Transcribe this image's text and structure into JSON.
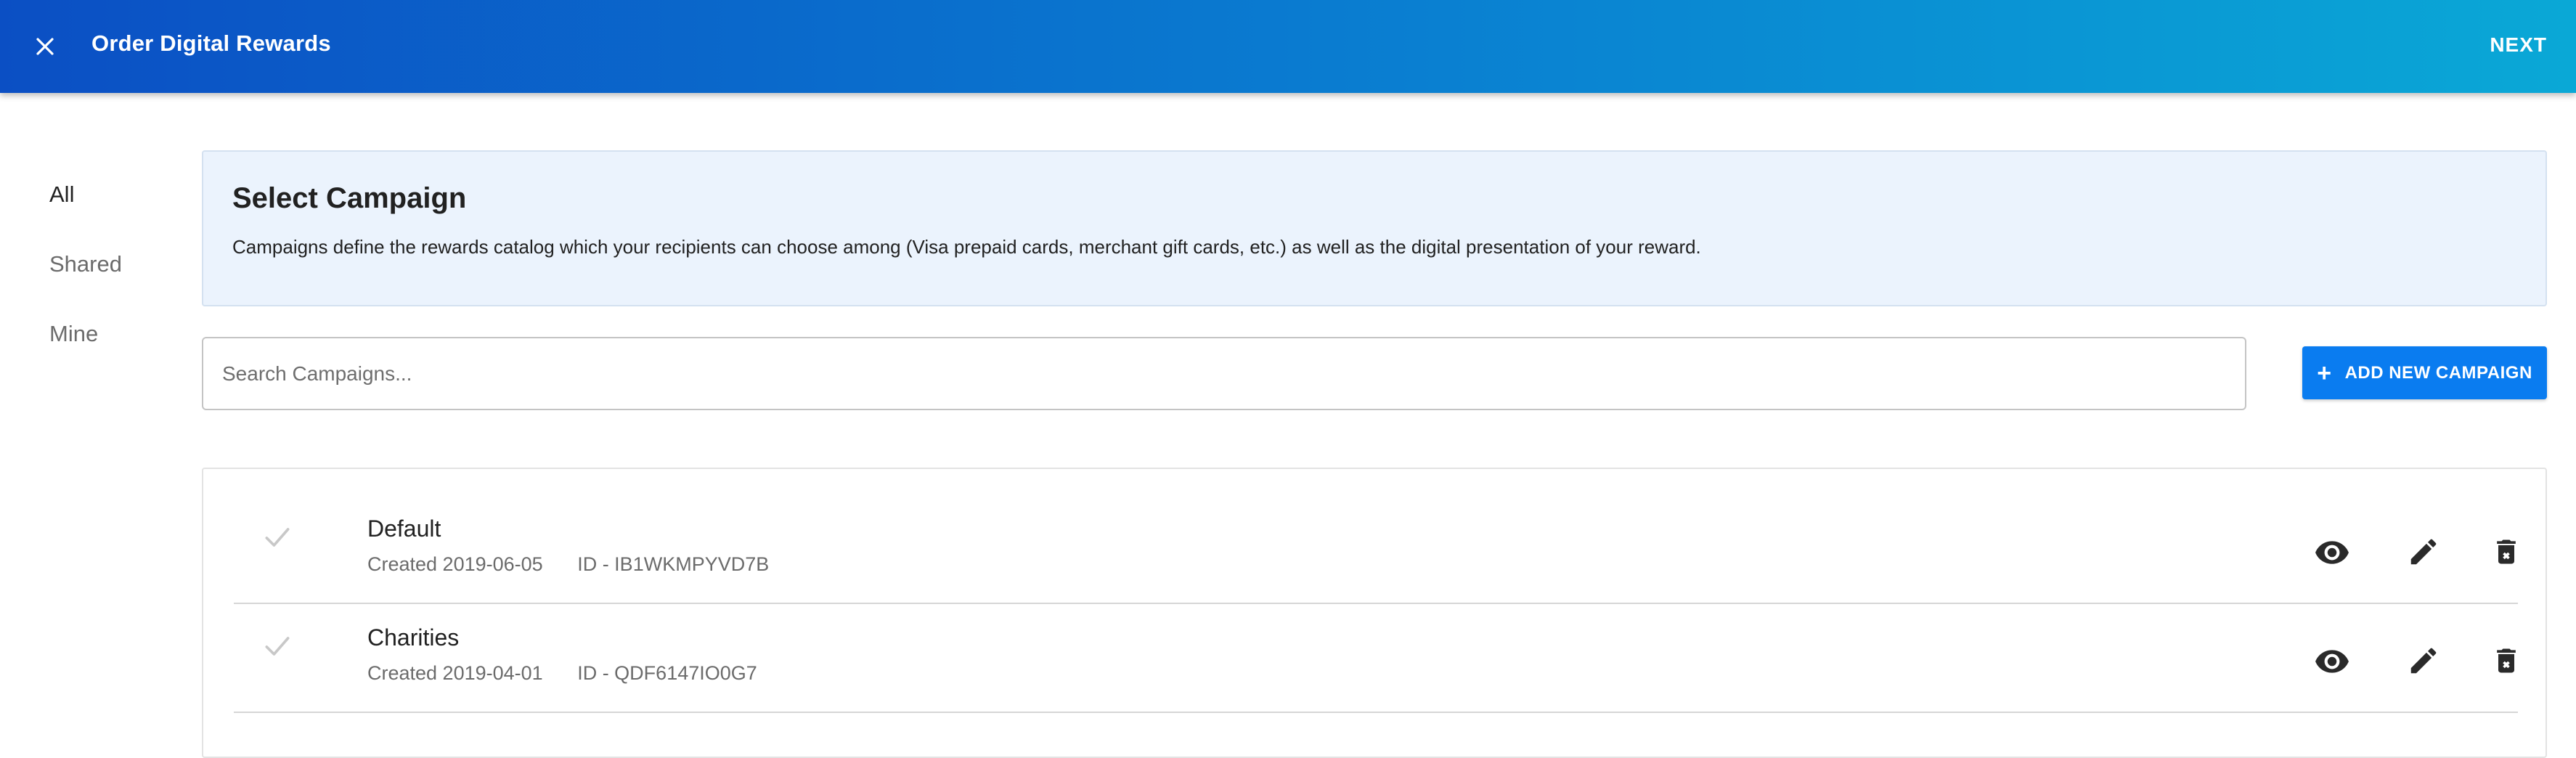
{
  "header": {
    "title": "Order Digital Rewards",
    "next_label": "NEXT",
    "close_icon": "close-icon"
  },
  "filters": [
    {
      "label": "All",
      "active": true
    },
    {
      "label": "Shared",
      "active": false
    },
    {
      "label": "Mine",
      "active": false
    }
  ],
  "info": {
    "title": "Select Campaign",
    "description": "Campaigns define the rewards catalog which your recipients can choose among (Visa prepaid cards, merchant gift cards, etc.) as well as the digital presentation of your reward."
  },
  "search": {
    "placeholder": "Search Campaigns...",
    "value": ""
  },
  "add_button": {
    "label": "ADD NEW CAMPAIGN",
    "icon": "plus-icon"
  },
  "campaigns": [
    {
      "name": "Default",
      "created": "Created 2019-06-05",
      "id": "ID - IB1WKMPYVD7B"
    },
    {
      "name": "Charities",
      "created": "Created 2019-04-01",
      "id": "ID - QDF6147IO0G7"
    }
  ],
  "row_actions": [
    "view-icon",
    "edit-icon",
    "delete-icon"
  ],
  "colors": {
    "header_gradient_start": "#0b4fc4",
    "header_gradient_end": "#0aa8d6",
    "primary_button": "#0a7cf0",
    "info_background": "#ebf3fd"
  }
}
